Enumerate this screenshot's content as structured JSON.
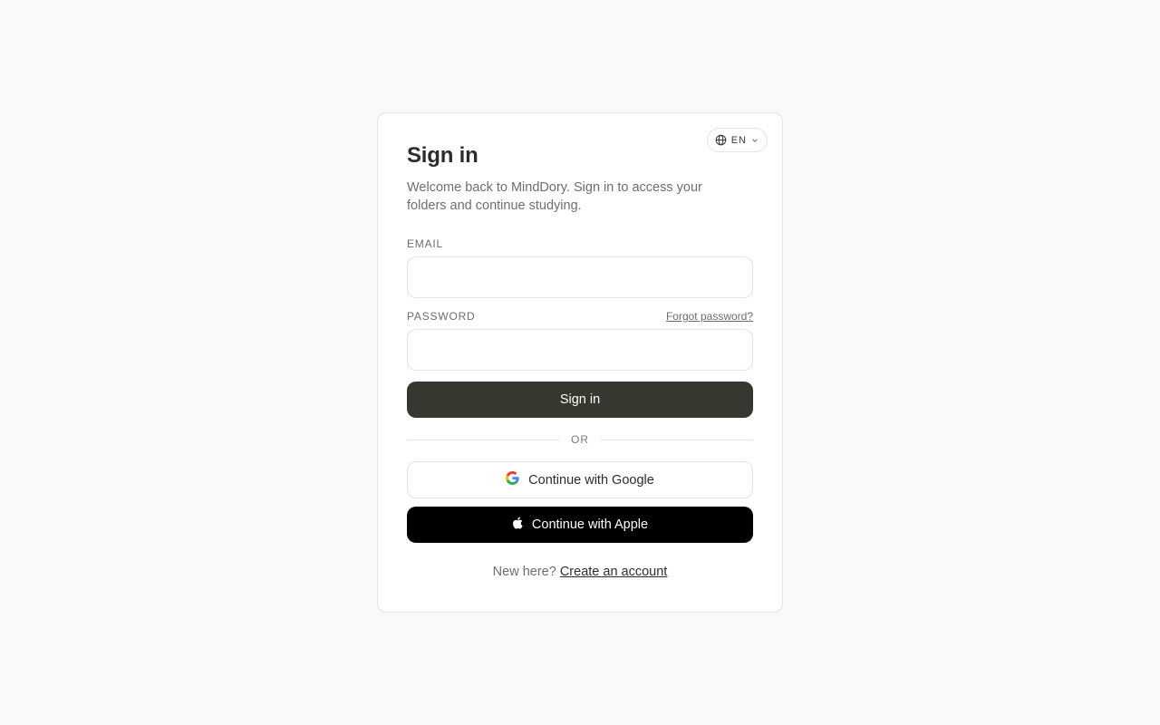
{
  "language": {
    "code": "EN",
    "icon": "globe-icon",
    "chevron": "chevron-down-icon"
  },
  "header": {
    "title": "Sign in",
    "subtitle": "Welcome back to MindDory. Sign in to access your folders and continue studying."
  },
  "form": {
    "email_label": "EMAIL",
    "email_value": "",
    "password_label": "PASSWORD",
    "password_value": "",
    "forgot_label": "Forgot password?",
    "submit_label": "Sign in"
  },
  "divider_label": "OR",
  "social": {
    "google_label": "Continue with Google",
    "google_icon": "google-icon",
    "apple_label": "Continue with Apple",
    "apple_icon": "apple-icon"
  },
  "footer": {
    "prompt": "New here?",
    "link_label": "Create an account"
  },
  "colors": {
    "background": "#f9f9f8",
    "primary_button": "#37362f",
    "apple_button": "#000000"
  }
}
